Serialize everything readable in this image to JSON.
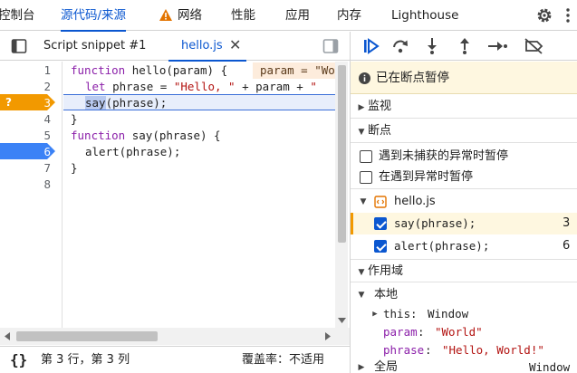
{
  "top_tabs": {
    "console": "控制台",
    "sources": "源代码/来源",
    "network": "网络",
    "performance": "性能",
    "application": "应用",
    "memory": "内存",
    "lighthouse": "Lighthouse"
  },
  "file_tabs": {
    "snippet": "Script snippet #1",
    "hello": "hello.js",
    "close": "✕"
  },
  "editor": {
    "line_numbers": [
      "1",
      "2",
      "3",
      "4",
      "5",
      "6",
      "7",
      "8"
    ],
    "inline_value": "param = \"World\"",
    "code": {
      "l1_kw": "function",
      "l1_rest": " hello(param) {",
      "l2_kw": "let",
      "l2_a": " phrase = ",
      "l2_str": "\"Hello, \"",
      "l2_b": " + param + ",
      "l2_str2": "\"",
      "l3_sel": "say",
      "l3_rest": "(phrase);",
      "l4": "}",
      "l5_kw": "function",
      "l5_rest": " say(phrase) {",
      "l6": "alert(phrase);",
      "l7": "}"
    },
    "paused_marker": "?"
  },
  "status": {
    "position": "第 3 行，第 3 列",
    "coverage": "覆盖率：不适用",
    "braces": "{}"
  },
  "debugger": {
    "paused_text": "已在断点暂停",
    "watch": "监视",
    "breakpoints": "断点",
    "pause_uncaught": "遇到未捕获的异常时暂停",
    "pause_caught": "在遇到异常时暂停",
    "file": "hello.js",
    "bp1_code": "say(phrase);",
    "bp1_line": "3",
    "bp2_code": "alert(phrase);",
    "bp2_line": "6",
    "scope": "作用域",
    "local": "本地",
    "this_key": "this",
    "this_val": "Window",
    "param_key": "param",
    "param_val": "\"World\"",
    "phrase_key": "phrase",
    "phrase_val": "\"Hello, World!\"",
    "global": "全局",
    "global_val": "Window"
  },
  "colors": {
    "accent": "#0b57d0",
    "paused_bg": "#fef7e0",
    "breakpoint_blue": "#3b82f6",
    "breakpoint_orange": "#f29900"
  }
}
